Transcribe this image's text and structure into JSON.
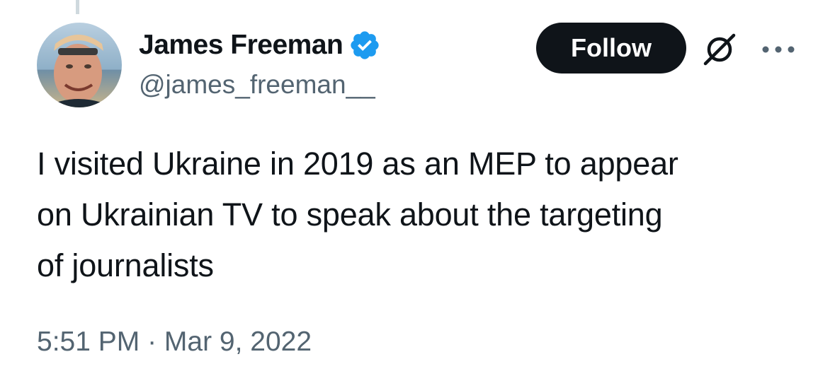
{
  "author": {
    "display_name": "James Freeman",
    "handle": "@james_freeman__",
    "verified": true
  },
  "actions": {
    "follow_label": "Follow",
    "icons": [
      "grok-icon",
      "more-options-icon"
    ]
  },
  "tweet": {
    "lines": [
      "I visited Ukraine in 2019 as an MEP to appear",
      "on Ukrainian TV to speak about the targeting",
      "of journalists"
    ],
    "timestamp": "5:51 PM · Mar 9, 2022"
  },
  "colors": {
    "text_primary": "#0f1419",
    "text_secondary": "#536471",
    "verified_blue": "#1d9bf0",
    "follow_bg": "#0f1419",
    "follow_text": "#ffffff"
  }
}
